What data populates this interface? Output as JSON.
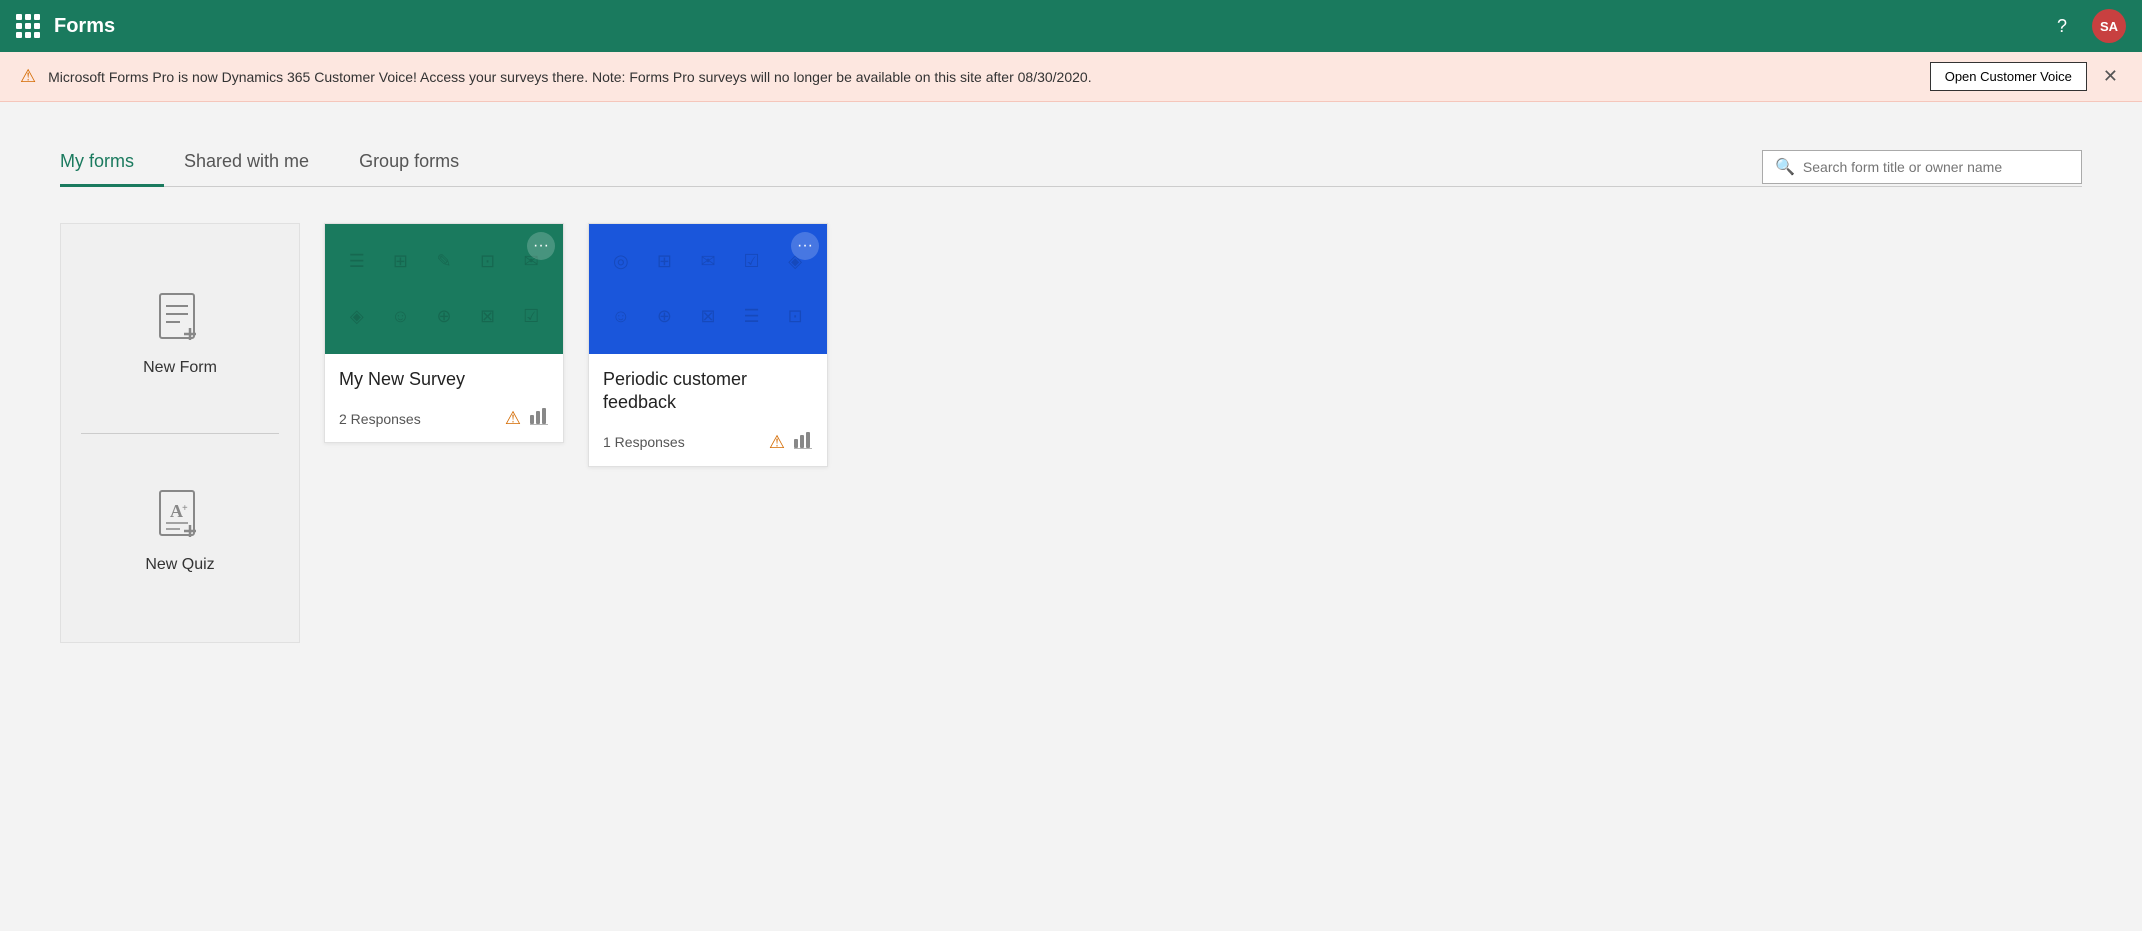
{
  "header": {
    "title": "Forms",
    "help_label": "?",
    "avatar_initials": "SA"
  },
  "banner": {
    "message": "Microsoft Forms Pro is now Dynamics 365 Customer Voice! Access your surveys there. Note: Forms Pro surveys will no longer be available on this site after 08/30/2020.",
    "open_button": "Open Customer Voice",
    "close_label": "✕"
  },
  "tabs": {
    "items": [
      {
        "id": "my-forms",
        "label": "My forms",
        "active": true
      },
      {
        "id": "shared-with-me",
        "label": "Shared with me",
        "active": false
      },
      {
        "id": "group-forms",
        "label": "Group forms",
        "active": false
      }
    ]
  },
  "search": {
    "placeholder": "Search form title or owner name"
  },
  "new_card": {
    "new_form_label": "New Form",
    "new_quiz_label": "New Quiz"
  },
  "forms": [
    {
      "id": "survey1",
      "title": "My New Survey",
      "responses": "2 Responses",
      "thumb_color": "green",
      "thumb_icons": [
        "☰",
        "⊞",
        "✎",
        "⊡",
        "✉",
        "◈",
        "☺",
        "⊕",
        "⊠",
        "☑"
      ]
    },
    {
      "id": "survey2",
      "title": "Periodic customer feedback",
      "responses": "1 Responses",
      "thumb_color": "blue",
      "thumb_icons": [
        "◎",
        "⊞",
        "✉",
        "☑",
        "◈",
        "☺",
        "⊕",
        "⊠",
        "☰",
        "⊡"
      ]
    }
  ],
  "colors": {
    "header_bg": "#1a7a5e",
    "banner_bg": "#fde7e0",
    "tab_active_color": "#1a7a5e",
    "green_thumb": "#1a7a5e",
    "blue_thumb": "#1a56db"
  }
}
